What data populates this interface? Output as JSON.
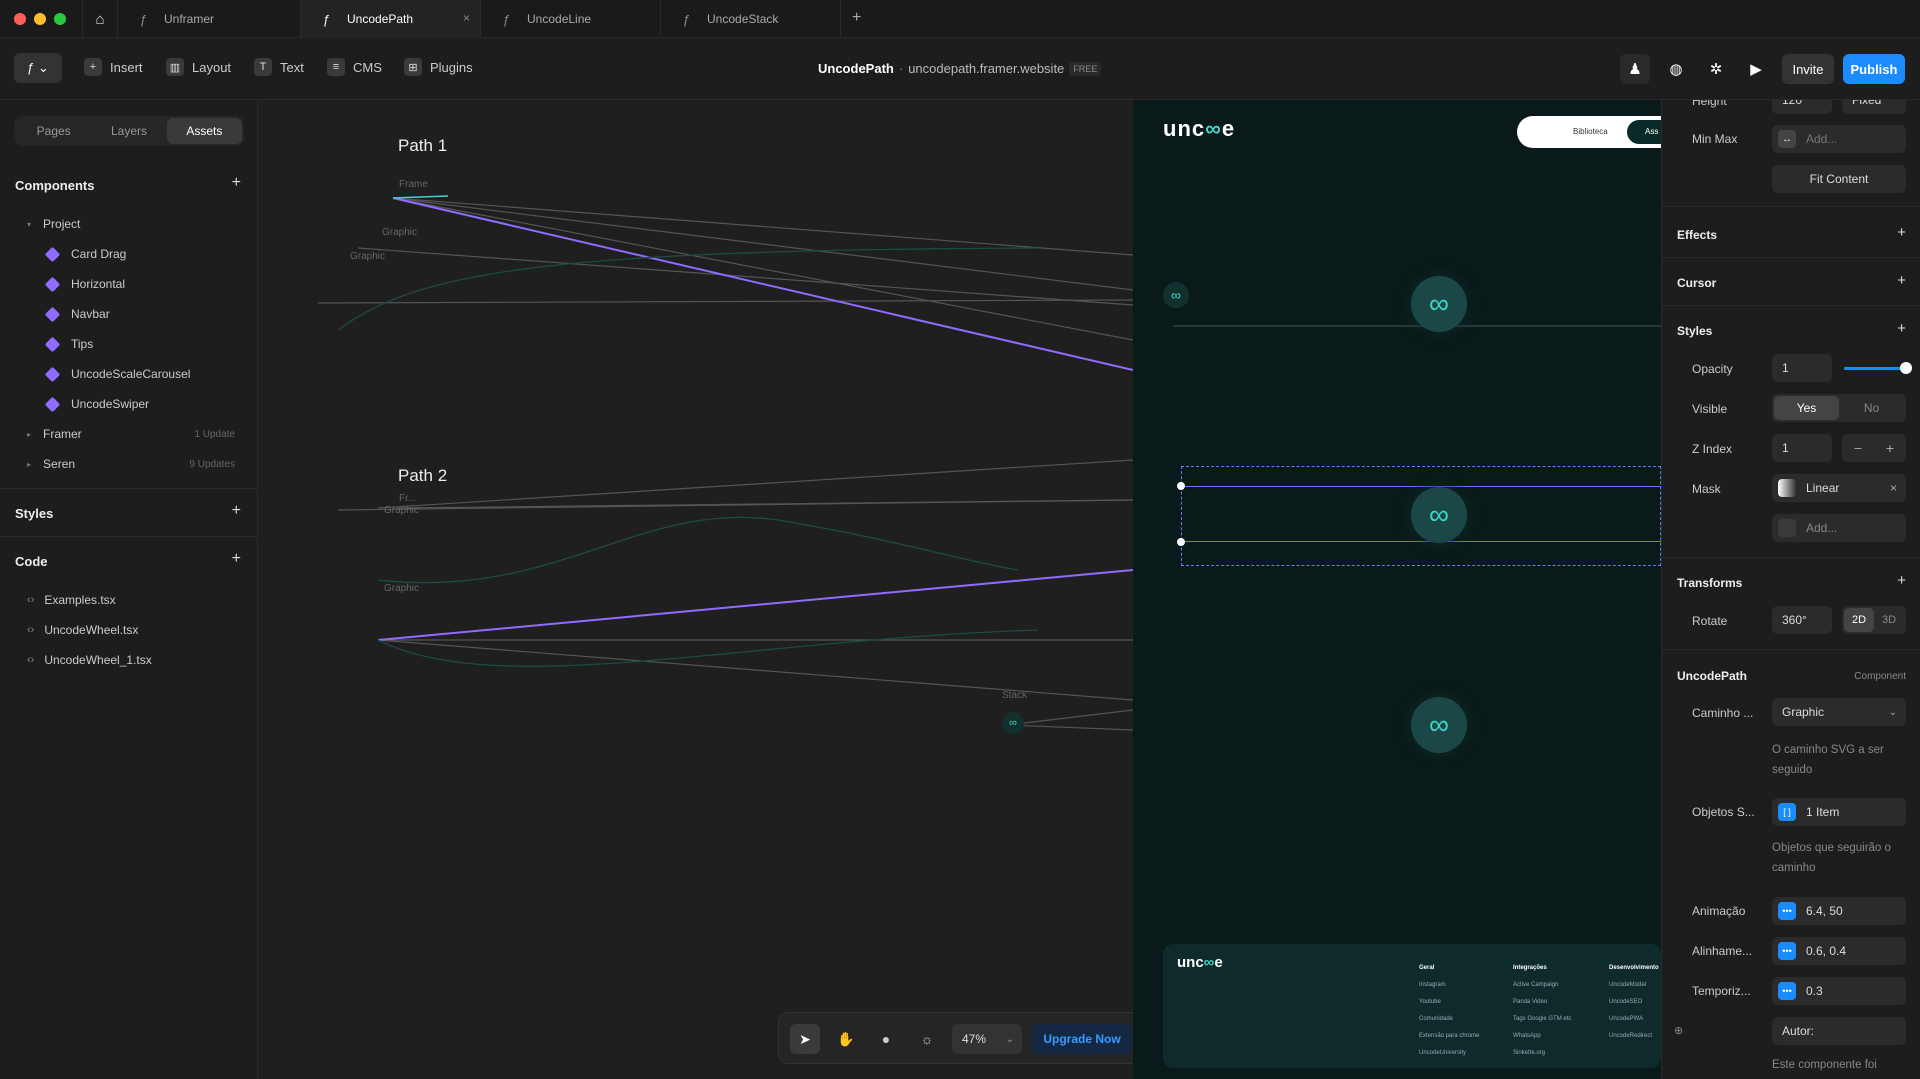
{
  "tabs": [
    {
      "label": "Unframer"
    },
    {
      "label": "UncodePath",
      "active": true
    },
    {
      "label": "UncodeLine"
    },
    {
      "label": "UncodeStack"
    }
  ],
  "toolbar": {
    "insert": "Insert",
    "layout": "Layout",
    "text": "Text",
    "cms": "CMS",
    "plugins": "Plugins",
    "project_name": "UncodePath",
    "separator": "·",
    "site": "uncodepath.framer.website",
    "plan": "FREE",
    "invite": "Invite",
    "publish": "Publish"
  },
  "left": {
    "tabs": [
      "Pages",
      "Layers",
      "Assets"
    ],
    "components_title": "Components",
    "project": "Project",
    "components": [
      "Card Drag",
      "Horizontal",
      "Navbar",
      "Tips",
      "UncodeScaleCarousel",
      "UncodeSwiper"
    ],
    "framer": "Framer",
    "framer_updates": "1 Update",
    "seren": "Seren",
    "seren_updates": "9 Updates",
    "styles_title": "Styles",
    "code_title": "Code",
    "code_files": [
      "Examples.tsx",
      "UncodeWheel.tsx",
      "UncodeWheel_1.tsx"
    ]
  },
  "canvas": {
    "path1": "Path 1",
    "path2": "Path 2",
    "frame": "Frame",
    "graphic": "Graphic",
    "fr": "Fr...",
    "stack": "Stack",
    "zoom": "47%",
    "upgrade": "Upgrade Now"
  },
  "preview": {
    "logo": "unc e",
    "nav1": "Biblioteca",
    "nav2": "Ass",
    "footer_cols": [
      {
        "title": "Geral",
        "items": [
          "Instagram",
          "Youtube",
          "Comunidade",
          "Extensão para chrome",
          "UncodeUniversity"
        ]
      },
      {
        "title": "Integrações",
        "items": [
          "Active Campaign",
          "Panda Video",
          "Tags Google GTM etc",
          "WhatsApp",
          "Sinkette.org"
        ]
      },
      {
        "title": "Desenvolvimento",
        "items": [
          "UncodeModal",
          "UncodeSEO",
          "UncodePWA",
          "UncodeRedirect"
        ]
      }
    ]
  },
  "right": {
    "height_label": "Height",
    "height_value": "120",
    "height_mode": "Fixed",
    "minmax": "Min Max",
    "add": "Add...",
    "fit": "Fit Content",
    "effects": "Effects",
    "cursor": "Cursor",
    "styles": "Styles",
    "opacity": "Opacity",
    "opacity_value": "1",
    "opacity_level": 1,
    "visible": "Visible",
    "yes": "Yes",
    "no": "No",
    "zindex": "Z Index",
    "zindex_value": "1",
    "mask": "Mask",
    "mask_value": "Linear",
    "mask_add": "Add...",
    "transforms": "Transforms",
    "rotate": "Rotate",
    "rotate_value": "360°",
    "d2": "2D",
    "d3": "3D",
    "component_name": "UncodePath",
    "component_tag": "Component",
    "caminho": "Caminho ...",
    "caminho_value": "Graphic",
    "caminho_help": "O caminho SVG a ser seguido",
    "objetos": "Objetos S...",
    "objetos_value": "1 Item",
    "objetos_help": "Objetos que seguirão o caminho",
    "animacao": "Animação",
    "animacao_value": "6.4, 50",
    "alinhamento": "Alinhame...",
    "alinhamento_value": "0.6, 0.4",
    "temporiz": "Temporiz...",
    "temporiz_value": "0.3",
    "autor": "Autor:",
    "footer_text": "Este componente foi"
  },
  "colors": {
    "accent": "#1a8cff",
    "purple": "#8f6cff",
    "teal": "#3fd6c8"
  }
}
